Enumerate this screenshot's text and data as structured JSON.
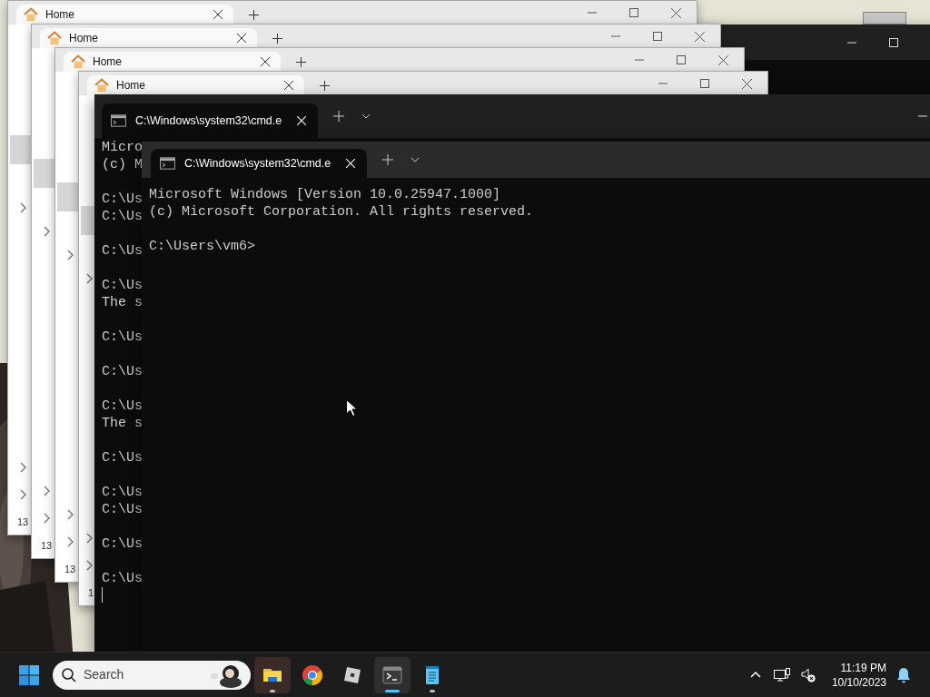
{
  "explorer_windows": [
    {
      "tab_title": "Home",
      "sidebar_count": "13"
    },
    {
      "tab_title": "Home",
      "sidebar_count": "13"
    },
    {
      "tab_title": "Home",
      "sidebar_count": "13"
    },
    {
      "tab_title": "Home",
      "sidebar_count": "1"
    }
  ],
  "back_terminal": {
    "tab_title": "C:\\Windows\\system32\\cmd.e",
    "blocks": [
      [
        "Micro",
        "(c) M"
      ],
      [
        "C:\\Us",
        "C:\\Us"
      ],
      [
        "C:\\Us"
      ],
      [
        "C:\\Us",
        "The s"
      ],
      [
        "C:\\Us"
      ],
      [
        "C:\\Us"
      ],
      [
        "C:\\Us",
        "The s"
      ],
      [
        "C:\\Us"
      ],
      [
        "C:\\Us",
        "C:\\Us"
      ],
      [
        "C:\\Us"
      ],
      [
        "C:\\Us"
      ]
    ]
  },
  "front_terminal": {
    "tab_title": "C:\\Windows\\system32\\cmd.e",
    "blocks": [
      [
        "Microsoft Windows [Version 10.0.25947.1000]",
        "(c) Microsoft Corporation. All rights reserved."
      ],
      [
        "C:\\Users\\vm6>"
      ]
    ]
  },
  "taskbar": {
    "search": {
      "placeholder": "Search"
    },
    "apps": [
      {
        "kind": "folder",
        "selected": false,
        "hovered": true,
        "running": true
      },
      {
        "kind": "browser",
        "selected": false,
        "hovered": false,
        "running": false
      },
      {
        "kind": "block",
        "selected": false,
        "hovered": false,
        "running": false
      },
      {
        "kind": "terminal",
        "selected": true,
        "hovered": false,
        "running": true
      },
      {
        "kind": "notepad",
        "selected": false,
        "hovered": false,
        "running": true
      }
    ],
    "clock": {
      "time": "11:19 PM",
      "date": "10/10/2023"
    }
  }
}
